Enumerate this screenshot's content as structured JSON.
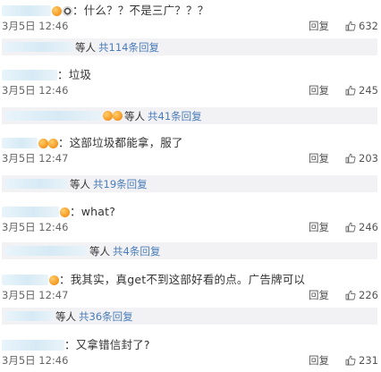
{
  "ui": {
    "reply_label": "回复",
    "deng_label": "等人"
  },
  "comments": [
    {
      "text": "：什么？？不是三广？？？",
      "time": "3月5日 12:46",
      "likes": "632",
      "thread": "共114条回复"
    },
    {
      "text": "：垃圾",
      "time": "3月5日 12:46",
      "likes": "245",
      "thread": "共41条回复"
    },
    {
      "text": "：这部垃圾都能拿，服了",
      "time": "3月5日 12:47",
      "likes": "203",
      "thread": "共19条回复"
    },
    {
      "text": "：what?",
      "time": "3月5日 12:46",
      "likes": "246",
      "thread": "共4条回复"
    },
    {
      "text": "：我其实，真get不到这部好看的点。广告牌可以",
      "time": "3月5日 12:47",
      "likes": "226",
      "thread": "共36条回复"
    },
    {
      "text": "：又拿错信封了?",
      "time": "3月5日 12:46",
      "likes": "231"
    }
  ]
}
